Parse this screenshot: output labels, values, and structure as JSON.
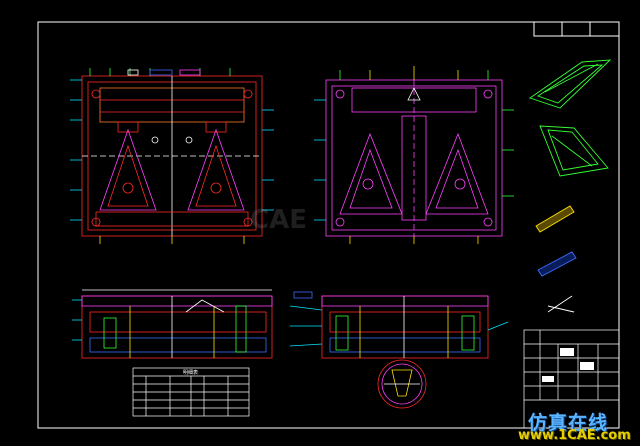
{
  "drawing": {
    "background": "#000000",
    "colors": {
      "border": "#ffffff",
      "red": "#ff2a2a",
      "magenta": "#ff40ff",
      "cyan": "#00e5ff",
      "green": "#34ff34",
      "yellow": "#ffe100",
      "blue": "#3a6dff",
      "white": "#ffffff"
    },
    "bom_table_title": "明细表",
    "watermark_cn": "仿真在线",
    "watermark_url": "www.1CAE.com",
    "center_watermark": "CAE"
  }
}
